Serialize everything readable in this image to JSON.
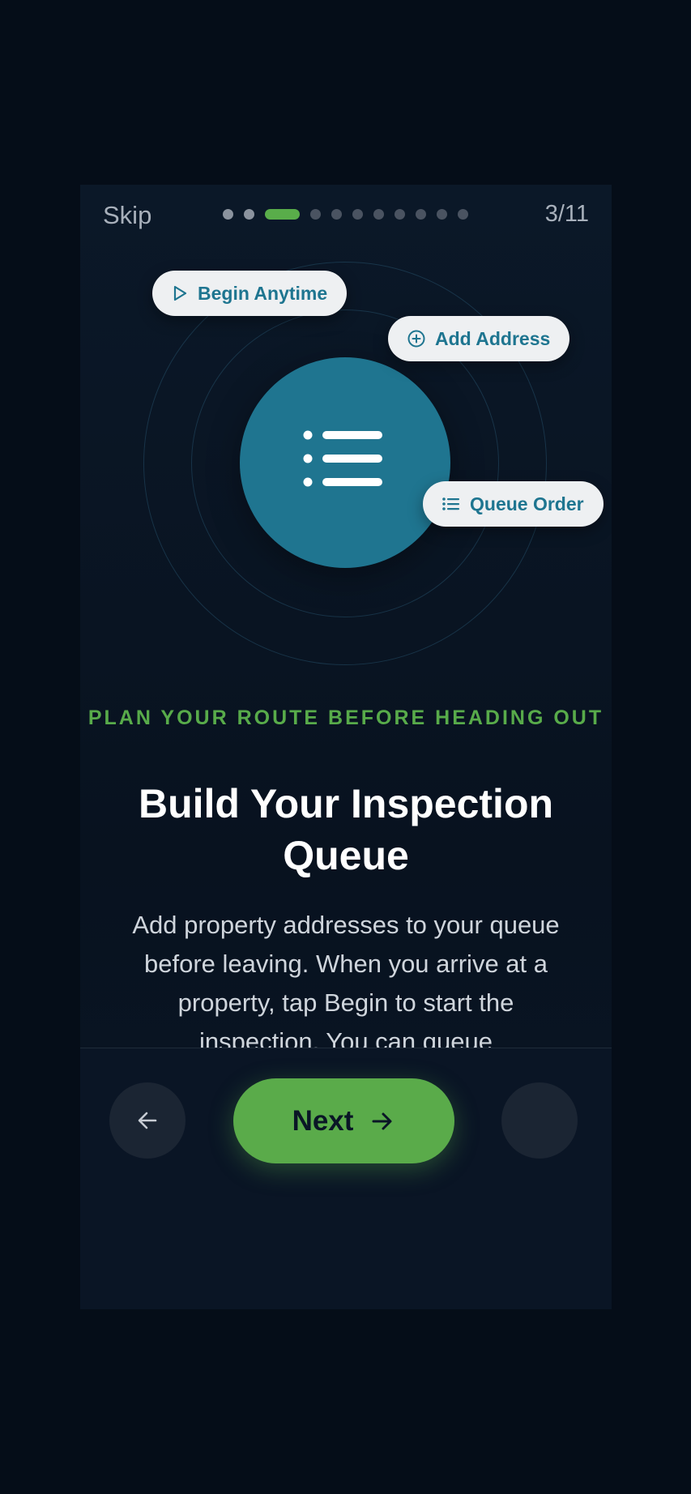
{
  "header": {
    "skip_label": "Skip",
    "counter": "3/11",
    "progress": {
      "current": 3,
      "total": 11
    }
  },
  "chips": {
    "begin_anytime": "Begin Anytime",
    "add_address": "Add Address",
    "queue_order": "Queue Order"
  },
  "content": {
    "eyebrow": "PLAN YOUR ROUTE BEFORE HEADING OUT",
    "title": "Build Your Inspection Queue",
    "body": "Add property addresses to your queue before leaving. When you arrive at a property, tap Begin to start the inspection. You can queue"
  },
  "footer": {
    "next_label": "Next"
  },
  "colors": {
    "accent_green": "#5aab4a",
    "hero_teal": "#1f7590",
    "background": "#050d18"
  },
  "icons": [
    "play-outline-icon",
    "plus-circle-icon",
    "list-icon",
    "arrow-left-icon",
    "arrow-right-icon"
  ]
}
